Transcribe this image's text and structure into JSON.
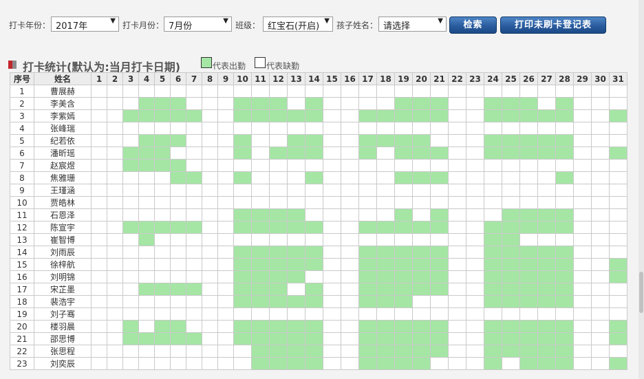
{
  "filters": {
    "year_label": "打卡年份：",
    "year_value": "2017年",
    "month_label": "打卡月份：",
    "month_value": "7月份",
    "class_label": "班级：",
    "class_value": "红宝石(开启)",
    "child_label": "孩子姓名：",
    "child_value": "请选择",
    "arrow_icon": "▼",
    "search_button": "检索",
    "print_button": "打印未刷卡登记表"
  },
  "stats": {
    "title": "打卡统计(默认为:当月打卡日期)",
    "legend_present": "代表出勤",
    "legend_absent": "代表缺勤",
    "present_color": "#a5e6a5",
    "marker_colors": [
      "#c0272d",
      "#8c8c8c"
    ]
  },
  "table": {
    "col_index": "序号",
    "col_name": "姓名",
    "days": [
      "1",
      "2",
      "3",
      "4",
      "5",
      "6",
      "7",
      "8",
      "9",
      "10",
      "11",
      "12",
      "13",
      "14",
      "15",
      "16",
      "17",
      "18",
      "19",
      "20",
      "21",
      "22",
      "23",
      "24",
      "25",
      "26",
      "27",
      "28",
      "29",
      "30",
      "31"
    ],
    "rows": [
      {
        "index": "1",
        "name": "曹展赫",
        "present": []
      },
      {
        "index": "2",
        "name": "李美含",
        "present": [
          4,
          5,
          6,
          10,
          11,
          12,
          14,
          19,
          20,
          21,
          24,
          25,
          26,
          28
        ]
      },
      {
        "index": "3",
        "name": "李紫嫣",
        "present": [
          3,
          4,
          5,
          6,
          7,
          10,
          11,
          12,
          13,
          14,
          17,
          18,
          19,
          20,
          21,
          24,
          25,
          26,
          27,
          28,
          31
        ]
      },
      {
        "index": "4",
        "name": "张峰瑞",
        "present": []
      },
      {
        "index": "5",
        "name": "纪若依",
        "present": [
          4,
          5,
          6,
          10,
          13,
          14,
          17,
          18,
          19,
          20,
          24,
          25,
          26,
          27,
          28
        ]
      },
      {
        "index": "6",
        "name": "潘昕瑶",
        "present": [
          3,
          4,
          5,
          10,
          12,
          13,
          14,
          17,
          19,
          20,
          21,
          24,
          25,
          26,
          27,
          28,
          31
        ]
      },
      {
        "index": "7",
        "name": "赵宸煜",
        "present": [
          3,
          4,
          5,
          6
        ]
      },
      {
        "index": "8",
        "name": "焦雅珊",
        "present": [
          6,
          7,
          10,
          14,
          19,
          20,
          21,
          28
        ]
      },
      {
        "index": "9",
        "name": "王瑾涵",
        "present": []
      },
      {
        "index": "10",
        "name": "贾皓林",
        "present": []
      },
      {
        "index": "11",
        "name": "石恩泽",
        "present": [
          10,
          11,
          12,
          13,
          19,
          21,
          25,
          26,
          27,
          28
        ]
      },
      {
        "index": "12",
        "name": "陈宣宇",
        "present": [
          3,
          4,
          5,
          6,
          7,
          10,
          11,
          12,
          13,
          14,
          17,
          18,
          19,
          20,
          21,
          24,
          25,
          26,
          27,
          28
        ]
      },
      {
        "index": "13",
        "name": "崔智博",
        "present": [
          4,
          24,
          25
        ]
      },
      {
        "index": "14",
        "name": "刘雨辰",
        "present": [
          10,
          11,
          12,
          13,
          14,
          17,
          18,
          19,
          20,
          21,
          24,
          25,
          26,
          27,
          28
        ]
      },
      {
        "index": "15",
        "name": "徐梓航",
        "present": [
          10,
          11,
          12,
          13,
          14,
          17,
          18,
          19,
          20,
          21,
          24,
          25,
          26,
          27,
          28,
          31
        ]
      },
      {
        "index": "16",
        "name": "刘明锦",
        "present": [
          10,
          11,
          12,
          13,
          17,
          18,
          19,
          20,
          21,
          24,
          25,
          26,
          27,
          28,
          31
        ]
      },
      {
        "index": "17",
        "name": "宋芷墨",
        "present": [
          4,
          5,
          6,
          7,
          10,
          11,
          12,
          14,
          17,
          18,
          19,
          20,
          21,
          24,
          25,
          26,
          27,
          28
        ]
      },
      {
        "index": "18",
        "name": "裴浩宇",
        "present": [
          10,
          11,
          12,
          13,
          14,
          17,
          18,
          19,
          24,
          25,
          26,
          27,
          28
        ]
      },
      {
        "index": "19",
        "name": "刘子骞",
        "present": []
      },
      {
        "index": "20",
        "name": "楼羽晨",
        "present": [
          3,
          5,
          6,
          10,
          11,
          12,
          13,
          14,
          17,
          18,
          19,
          20,
          21,
          24,
          25,
          26,
          27,
          28,
          31
        ]
      },
      {
        "index": "21",
        "name": "邵思博",
        "present": [
          3,
          4,
          5,
          6,
          7,
          10,
          11,
          12,
          13,
          14,
          17,
          18,
          19,
          20,
          21,
          24,
          25,
          26,
          27,
          28,
          31
        ]
      },
      {
        "index": "22",
        "name": "张思程",
        "present": [
          11,
          12,
          13,
          14,
          17,
          18,
          19,
          20,
          21,
          24,
          25,
          26,
          27,
          28
        ]
      },
      {
        "index": "23",
        "name": "刘奕辰",
        "present": [
          11,
          12,
          13,
          14,
          17,
          18,
          19,
          20,
          24,
          26,
          27,
          28,
          31
        ]
      }
    ]
  }
}
